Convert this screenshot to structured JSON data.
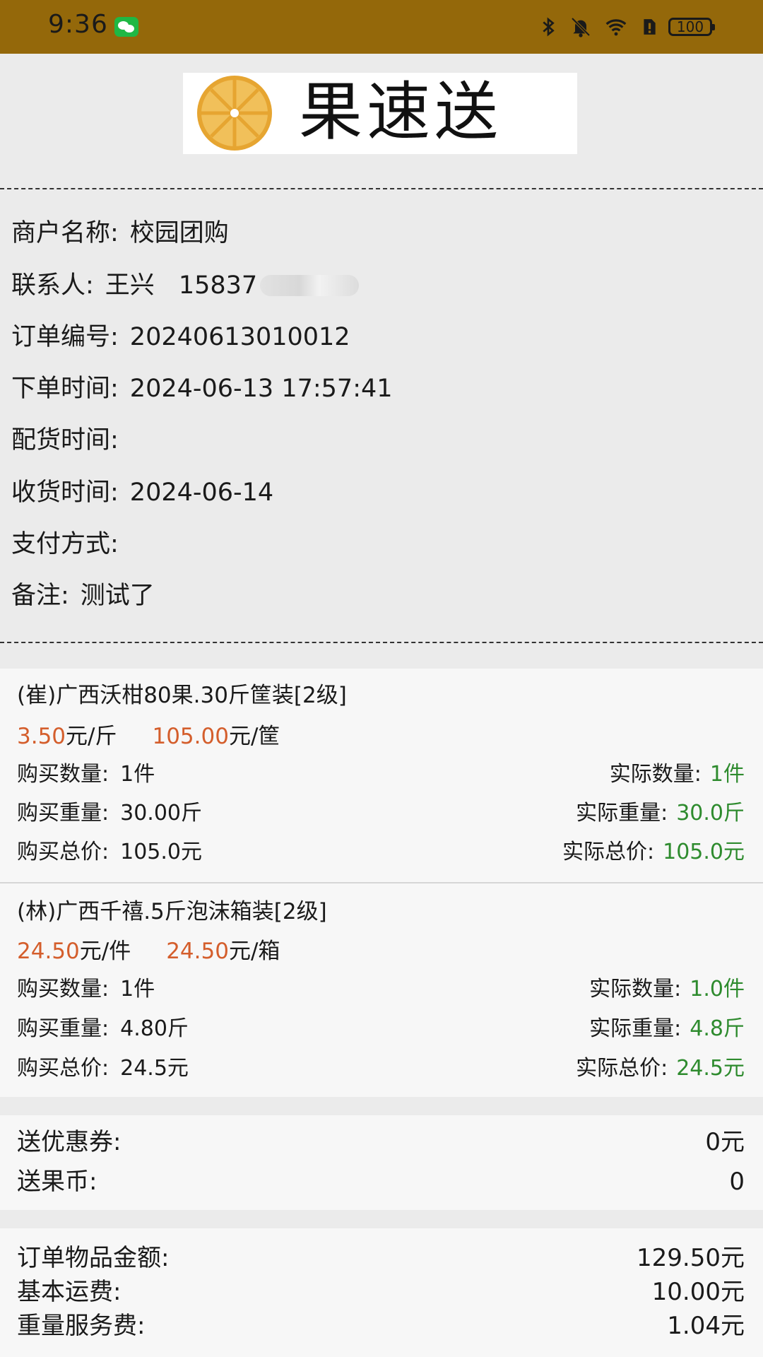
{
  "status_bar": {
    "time": "9:36",
    "battery": "100",
    "icons": [
      "wechat-icon",
      "bluetooth-icon",
      "mute-bell-icon",
      "wifi-icon",
      "alert-icon",
      "battery-icon"
    ]
  },
  "logo": {
    "text": "果速送",
    "icon": "orange-slice-icon"
  },
  "order_info": {
    "merchant_label": "商户名称:",
    "merchant_value": "校园团购",
    "contact_label": "联系人:",
    "contact_name": "王兴",
    "contact_phone": "15837",
    "order_no_label": "订单编号:",
    "order_no_value": "20240613010012",
    "order_time_label": "下单时间:",
    "order_time_value": "2024-06-13 17:57:41",
    "dispatch_time_label": "配货时间:",
    "receive_time_label": "收货时间:",
    "receive_time_value": "2024-06-14",
    "payment_label": "支付方式:",
    "remark_label": "备注:",
    "remark_value": "测试了"
  },
  "items": [
    {
      "title": "(崔)广西沃柑80果.30斤筐装[2级]",
      "unit_price": "3.50",
      "unit_price_unit": "元/斤",
      "pack_price": "105.00",
      "pack_price_unit": "元/筐",
      "buy_qty_label": "购买数量:",
      "buy_qty": "1件",
      "actual_qty_label": "实际数量:",
      "actual_qty": "1件",
      "buy_weight_label": "购买重量:",
      "buy_weight": "30.00斤",
      "actual_weight_label": "实际重量:",
      "actual_weight": "30.0斤",
      "buy_total_label": "购买总价:",
      "buy_total": "105.0元",
      "actual_total_label": "实际总价:",
      "actual_total": "105.0元"
    },
    {
      "title": "(林)广西千禧.5斤泡沫箱装[2级]",
      "unit_price": "24.50",
      "unit_price_unit": "元/件",
      "pack_price": "24.50",
      "pack_price_unit": "元/箱",
      "buy_qty_label": "购买数量:",
      "buy_qty": "1件",
      "actual_qty_label": "实际数量:",
      "actual_qty": "1.0件",
      "buy_weight_label": "购买重量:",
      "buy_weight": "4.80斤",
      "actual_weight_label": "实际重量:",
      "actual_weight": "4.8斤",
      "buy_total_label": "购买总价:",
      "buy_total": "24.5元",
      "actual_total_label": "实际总价:",
      "actual_total": "24.5元"
    }
  ],
  "promo": {
    "coupon_label": "送优惠券:",
    "coupon_value": "0元",
    "coin_label": "送果币:",
    "coin_value": "0"
  },
  "totals": {
    "goods_label": "订单物品金额:",
    "goods_value": "129.50元",
    "shipping_label": "基本运费:",
    "shipping_value": "10.00元",
    "weight_fee_label": "重量服务费:",
    "weight_fee_value": "1.04元"
  },
  "colors": {
    "status_bar": "#94680a",
    "price_orange": "#d45e2c",
    "actual_green": "#2e8b2e",
    "page_bg": "#ebebeb",
    "card_bg": "#f7f7f7"
  }
}
